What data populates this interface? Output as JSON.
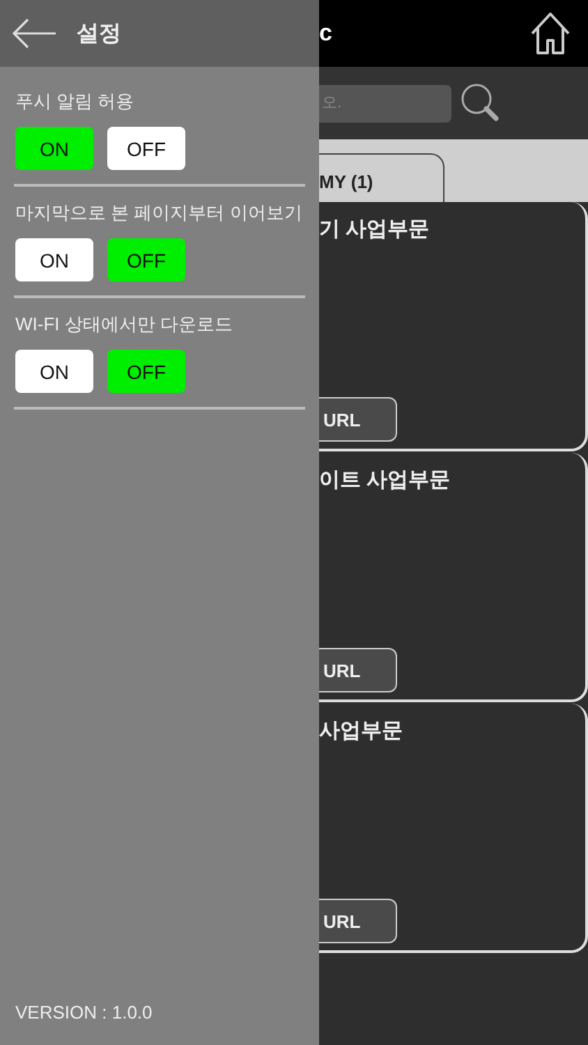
{
  "drawer": {
    "title": "설정",
    "settings": [
      {
        "label": "푸시 알림 허용",
        "options": [
          {
            "label": "ON",
            "selected": true
          },
          {
            "label": "OFF",
            "selected": false
          }
        ]
      },
      {
        "label": "마지막으로 본 페이지부터 이어보기",
        "options": [
          {
            "label": "ON",
            "selected": false
          },
          {
            "label": "OFF",
            "selected": true
          }
        ]
      },
      {
        "label": "WI-FI 상태에서만 다운로드",
        "options": [
          {
            "label": "ON",
            "selected": false
          },
          {
            "label": "OFF",
            "selected": true
          }
        ]
      }
    ],
    "version": "VERSION : 1.0.0"
  },
  "background": {
    "header_title": "c",
    "search": {
      "placeholder": "오."
    },
    "tabs": [
      {
        "label": "MY (1)"
      }
    ],
    "cards": [
      {
        "title": "기 사업부문",
        "button": "URL"
      },
      {
        "title": "이트 사업부문",
        "button": "URL"
      },
      {
        "title": "사업부문",
        "button": "URL"
      }
    ]
  }
}
